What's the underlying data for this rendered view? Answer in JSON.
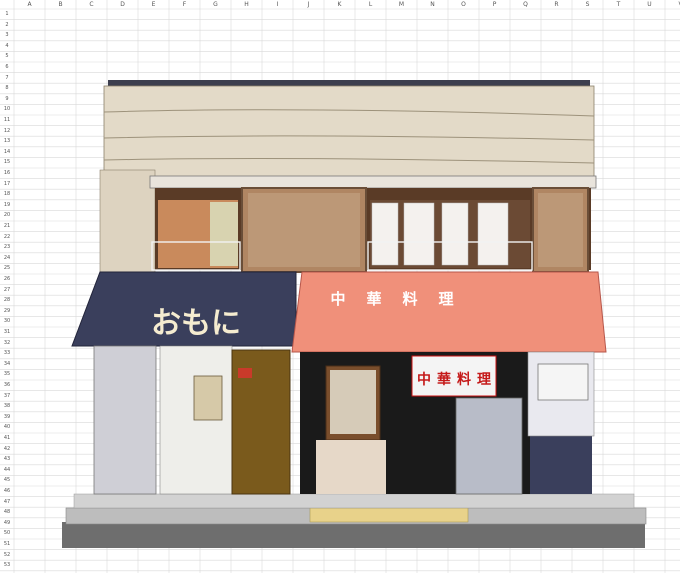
{
  "spreadsheet": {
    "columns": [
      "A",
      "B",
      "C",
      "D",
      "E",
      "F",
      "G",
      "H",
      "I",
      "J",
      "K",
      "L",
      "M",
      "N",
      "O",
      "P",
      "Q",
      "R",
      "S",
      "T",
      "U",
      "V"
    ],
    "rows": [
      "1",
      "2",
      "3",
      "4",
      "5",
      "6",
      "7",
      "8",
      "9",
      "10",
      "11",
      "12",
      "13",
      "14",
      "15",
      "16",
      "17",
      "18",
      "19",
      "20",
      "21",
      "22",
      "23",
      "24",
      "25",
      "26",
      "27",
      "28",
      "29",
      "30",
      "31",
      "32",
      "33",
      "34",
      "35",
      "36",
      "37",
      "38",
      "39",
      "40",
      "41",
      "42",
      "43",
      "44",
      "45",
      "46",
      "47",
      "48",
      "49",
      "50",
      "51",
      "52",
      "53"
    ]
  },
  "storefront": {
    "left_sign": "おもに",
    "right_awning": [
      "中",
      "華",
      "料",
      "理"
    ],
    "noren": [
      "中",
      "華",
      "料",
      "理"
    ]
  },
  "colors": {
    "awning_salmon": "#f0907a",
    "awning_navy": "#3a3f5c",
    "wall": "#e6dccb",
    "grid": "#d9d9d9"
  }
}
